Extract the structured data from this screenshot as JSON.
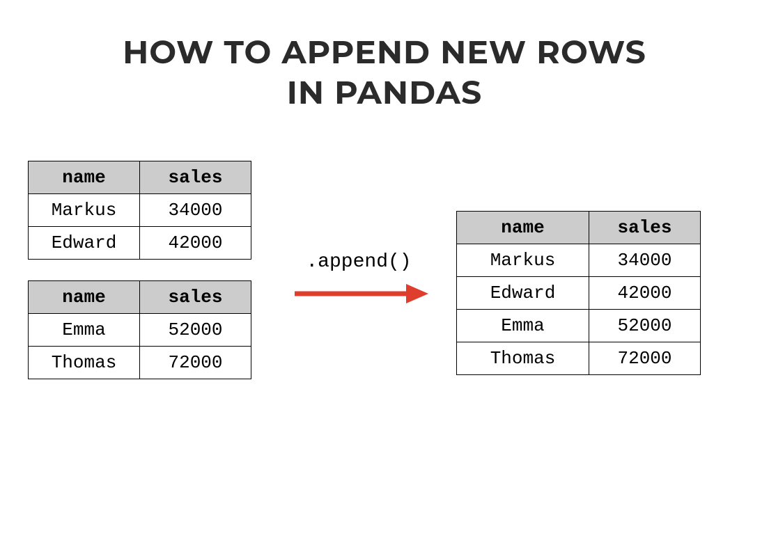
{
  "title_line1": "HOW TO APPEND NEW ROWS",
  "title_line2": "IN PANDAS",
  "method_label": ".append()",
  "arrow_color": "#e03e2d",
  "table1": {
    "headers": {
      "c0": "name",
      "c1": "sales"
    },
    "rows": [
      {
        "name": "Markus",
        "sales": "34000"
      },
      {
        "name": "Edward",
        "sales": "42000"
      }
    ]
  },
  "table2": {
    "headers": {
      "c0": "name",
      "c1": "sales"
    },
    "rows": [
      {
        "name": "Emma",
        "sales": "52000"
      },
      {
        "name": "Thomas",
        "sales": "72000"
      }
    ]
  },
  "result": {
    "headers": {
      "c0": "name",
      "c1": "sales"
    },
    "rows": [
      {
        "name": "Markus",
        "sales": "34000"
      },
      {
        "name": "Edward",
        "sales": "42000"
      },
      {
        "name": "Emma",
        "sales": "52000"
      },
      {
        "name": "Thomas",
        "sales": "72000"
      }
    ]
  }
}
